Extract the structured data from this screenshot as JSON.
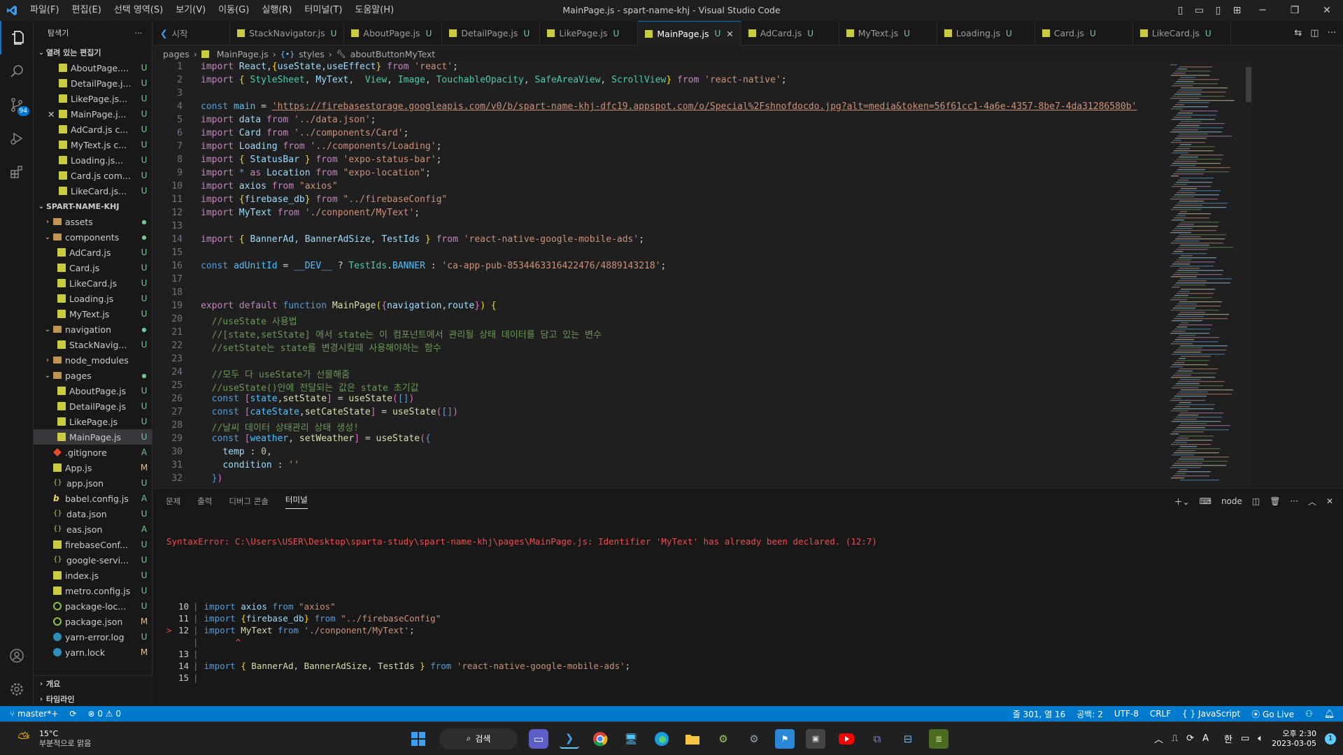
{
  "window": {
    "title": "MainPage.js - spart-name-khj - Visual Studio Code"
  },
  "menu": [
    "파일(F)",
    "편집(E)",
    "선택 영역(S)",
    "보기(V)",
    "이동(G)",
    "실행(R)",
    "터미널(T)",
    "도움말(H)"
  ],
  "activity": {
    "scm_badge": "94"
  },
  "sidebar": {
    "title": "탐색기",
    "more": "···",
    "open_editors_title": "열려 있는 편집기",
    "open_editors": [
      {
        "name": "AboutPage....",
        "status": "U"
      },
      {
        "name": "DetailPage.j...",
        "status": "U"
      },
      {
        "name": "LikePage.js...",
        "status": "U"
      },
      {
        "name": "MainPage.j...",
        "status": "U"
      },
      {
        "name": "AdCard.js c...",
        "status": "U"
      },
      {
        "name": "MyText.js c...",
        "status": "U"
      },
      {
        "name": "Loading.js...",
        "status": "U"
      },
      {
        "name": "Card.js com...",
        "status": "U"
      },
      {
        "name": "LikeCard.js...",
        "status": "U"
      }
    ],
    "project_title": "SPART-NAME-KHJ",
    "tree": [
      {
        "name": "assets",
        "type": "folder",
        "status": "●"
      },
      {
        "name": "components",
        "type": "folder-open",
        "status": "●"
      },
      {
        "name": "AdCard.js",
        "type": "js",
        "status": "U",
        "indent": 2
      },
      {
        "name": "Card.js",
        "type": "js",
        "status": "U",
        "indent": 2
      },
      {
        "name": "LikeCard.js",
        "type": "js",
        "status": "U",
        "indent": 2
      },
      {
        "name": "Loading.js",
        "type": "js",
        "status": "U",
        "indent": 2
      },
      {
        "name": "MyText.js",
        "type": "js",
        "status": "U",
        "indent": 2
      },
      {
        "name": "navigation",
        "type": "folder-open",
        "status": "●"
      },
      {
        "name": "StackNavig...",
        "type": "js",
        "status": "U",
        "indent": 2
      },
      {
        "name": "node_modules",
        "type": "folder",
        "status": ""
      },
      {
        "name": "pages",
        "type": "folder-open",
        "status": "●"
      },
      {
        "name": "AboutPage.js",
        "type": "js",
        "status": "U",
        "indent": 2
      },
      {
        "name": "DetailPage.js",
        "type": "js",
        "status": "U",
        "indent": 2
      },
      {
        "name": "LikePage.js",
        "type": "js",
        "status": "U",
        "indent": 2
      },
      {
        "name": "MainPage.js",
        "type": "js",
        "status": "U",
        "indent": 2,
        "selected": true
      },
      {
        "name": ".gitignore",
        "type": "git",
        "status": "A"
      },
      {
        "name": "App.js",
        "type": "js",
        "status": "M"
      },
      {
        "name": "app.json",
        "type": "json",
        "status": "U"
      },
      {
        "name": "babel.config.js",
        "type": "babel",
        "status": "A"
      },
      {
        "name": "data.json",
        "type": "json",
        "status": "U"
      },
      {
        "name": "eas.json",
        "type": "json",
        "status": "A"
      },
      {
        "name": "firebaseConf...",
        "type": "js",
        "status": "U"
      },
      {
        "name": "google-servi...",
        "type": "json",
        "status": "U"
      },
      {
        "name": "index.js",
        "type": "js",
        "status": "U"
      },
      {
        "name": "metro.config.js",
        "type": "js",
        "status": "U"
      },
      {
        "name": "package-loc...",
        "type": "pkg",
        "status": "U"
      },
      {
        "name": "package.json",
        "type": "pkg",
        "status": "M"
      },
      {
        "name": "yarn-error.log",
        "type": "yarn",
        "status": "U"
      },
      {
        "name": "yarn.lock",
        "type": "yarn",
        "status": "M"
      }
    ],
    "outline": "개요",
    "timeline": "타임라인"
  },
  "tabs": [
    {
      "label": "시작",
      "status": "",
      "kind": "vscode"
    },
    {
      "label": "StackNavigator.js",
      "status": "U"
    },
    {
      "label": "AboutPage.js",
      "status": "U"
    },
    {
      "label": "DetailPage.js",
      "status": "U"
    },
    {
      "label": "LikePage.js",
      "status": "U"
    },
    {
      "label": "MainPage.js",
      "status": "U",
      "active": true
    },
    {
      "label": "AdCard.js",
      "status": "U"
    },
    {
      "label": "MyText.js",
      "status": "U"
    },
    {
      "label": "Loading.js",
      "status": "U"
    },
    {
      "label": "Card.js",
      "status": "U"
    },
    {
      "label": "LikeCard.js",
      "status": "U"
    }
  ],
  "breadcrumbs": [
    "pages",
    "MainPage.js",
    "styles",
    "aboutButtonMyText"
  ],
  "code_lines": [
    [
      [
        "kw",
        "import "
      ],
      [
        "var",
        "React"
      ],
      [
        "",
        ","
      ],
      [
        "br",
        "{"
      ],
      [
        "var",
        "useState"
      ],
      [
        "",
        ","
      ],
      [
        "var",
        "useEffect"
      ],
      [
        "br",
        "}"
      ],
      [
        "kw",
        " from "
      ],
      [
        "str",
        "'react'"
      ],
      [
        "",
        ";"
      ]
    ],
    [
      [
        "kw",
        "import "
      ],
      [
        "br",
        "{ "
      ],
      [
        "cl",
        "StyleSheet"
      ],
      [
        "",
        ", "
      ],
      [
        "var",
        "MyText"
      ],
      [
        "",
        ",  "
      ],
      [
        "cl",
        "View"
      ],
      [
        "",
        ", "
      ],
      [
        "cl",
        "Image"
      ],
      [
        "",
        ", "
      ],
      [
        "cl",
        "TouchableOpacity"
      ],
      [
        "",
        ", "
      ],
      [
        "cl",
        "SafeAreaView"
      ],
      [
        "",
        ", "
      ],
      [
        "cl",
        "ScrollView"
      ],
      [
        "br",
        "}"
      ],
      [
        "kw",
        " from "
      ],
      [
        "str",
        "'react-native'"
      ],
      [
        "",
        ";"
      ]
    ],
    [],
    [
      [
        "kb",
        "const "
      ],
      [
        "cn",
        "main"
      ],
      [
        "",
        " = "
      ],
      [
        "str",
        "'https://firebasestorage.googleapis.com/v0/b/spart-name-khj-dfc19.appspot.com/o/Special%2Fshnofdocdo.jpg?alt=media&token=56f61cc1-4a6e-4357-8be7-4da31286580b'"
      ]
    ],
    [
      [
        "kw",
        "import "
      ],
      [
        "var",
        "data"
      ],
      [
        "kw",
        " from "
      ],
      [
        "str",
        "'../data.json'"
      ],
      [
        "",
        ";"
      ]
    ],
    [
      [
        "kw",
        "import "
      ],
      [
        "var",
        "Card"
      ],
      [
        "kw",
        " from "
      ],
      [
        "str",
        "'../components/Card'"
      ],
      [
        "",
        ";"
      ]
    ],
    [
      [
        "kw",
        "import "
      ],
      [
        "var",
        "Loading"
      ],
      [
        "kw",
        " from "
      ],
      [
        "str",
        "'../components/Loading'"
      ],
      [
        "",
        ";"
      ]
    ],
    [
      [
        "kw",
        "import "
      ],
      [
        "br",
        "{ "
      ],
      [
        "var",
        "StatusBar"
      ],
      [
        "br",
        " }"
      ],
      [
        "kw",
        " from "
      ],
      [
        "str",
        "'expo-status-bar'"
      ],
      [
        "",
        ";"
      ]
    ],
    [
      [
        "kw",
        "import "
      ],
      [
        "kb",
        "* "
      ],
      [
        "kw",
        "as "
      ],
      [
        "var",
        "Location"
      ],
      [
        "kw",
        " from "
      ],
      [
        "str",
        "\"expo-location\""
      ],
      [
        "",
        ";"
      ]
    ],
    [
      [
        "kw",
        "import "
      ],
      [
        "var",
        "axios"
      ],
      [
        "kw",
        " from "
      ],
      [
        "str",
        "\"axios\""
      ]
    ],
    [
      [
        "kw",
        "import "
      ],
      [
        "br",
        "{"
      ],
      [
        "var",
        "firebase_db"
      ],
      [
        "br",
        "}"
      ],
      [
        "kw",
        " from "
      ],
      [
        "str",
        "\"../firebaseConfig\""
      ]
    ],
    [
      [
        "kw",
        "import "
      ],
      [
        "var",
        "MyText"
      ],
      [
        "kw",
        " from "
      ],
      [
        "str",
        "'./conponent/MyText'"
      ],
      [
        "",
        ";"
      ]
    ],
    [],
    [
      [
        "kw",
        "import "
      ],
      [
        "br",
        "{ "
      ],
      [
        "var",
        "BannerAd"
      ],
      [
        "",
        ", "
      ],
      [
        "var",
        "BannerAdSize"
      ],
      [
        "",
        ", "
      ],
      [
        "var",
        "TestIds"
      ],
      [
        "br",
        " }"
      ],
      [
        "kw",
        " from "
      ],
      [
        "str",
        "'react-native-google-mobile-ads'"
      ],
      [
        "",
        ";"
      ]
    ],
    [],
    [
      [
        "kb",
        "const "
      ],
      [
        "cn",
        "adUnitId"
      ],
      [
        "",
        " = "
      ],
      [
        "cn",
        "__DEV__"
      ],
      [
        "",
        " ? "
      ],
      [
        "cl",
        "TestIds"
      ],
      [
        "",
        "."
      ],
      [
        "cn",
        "BANNER"
      ],
      [
        "",
        " : "
      ],
      [
        "str",
        "'ca-app-pub-8534463316422476/4889143218'"
      ],
      [
        "",
        ";"
      ]
    ],
    [],
    [],
    [
      [
        "kw",
        "export default "
      ],
      [
        "kb",
        "function "
      ],
      [
        "fn",
        "MainPage"
      ],
      [
        "br",
        "("
      ],
      [
        "br2",
        "{"
      ],
      [
        "var",
        "navigation"
      ],
      [
        "",
        ","
      ],
      [
        "var",
        "route"
      ],
      [
        "br2",
        "}"
      ],
      [
        "br",
        ")"
      ],
      [
        "",
        " "
      ],
      [
        "br",
        "{"
      ]
    ],
    [
      [
        "",
        "  "
      ],
      [
        "cm",
        "//useState 사용법"
      ]
    ],
    [
      [
        "",
        "  "
      ],
      [
        "cm",
        "//[state,setState] 에서 state는 이 컴포넌트에서 관리될 상태 데이터를 담고 있는 변수"
      ]
    ],
    [
      [
        "",
        "  "
      ],
      [
        "cm",
        "//setState는 state를 변경시킬때 사용해야하는 함수"
      ]
    ],
    [],
    [
      [
        "",
        "  "
      ],
      [
        "cm",
        "//모두 다 useState가 선물해줌"
      ]
    ],
    [
      [
        "",
        "  "
      ],
      [
        "cm",
        "//useState()안에 전달되는 값은 state 초기값"
      ]
    ],
    [
      [
        "",
        "  "
      ],
      [
        "kb",
        "const "
      ],
      [
        "br2",
        "["
      ],
      [
        "cn",
        "state"
      ],
      [
        "",
        ","
      ],
      [
        "fn",
        "setState"
      ],
      [
        "br2",
        "]"
      ],
      [
        "",
        " = "
      ],
      [
        "fn",
        "useState"
      ],
      [
        "br2",
        "("
      ],
      [
        "kb",
        "[]"
      ],
      [
        "br2",
        ")"
      ]
    ],
    [
      [
        "",
        "  "
      ],
      [
        "kb",
        "const "
      ],
      [
        "br2",
        "["
      ],
      [
        "cn",
        "cateState"
      ],
      [
        "",
        ","
      ],
      [
        "fn",
        "setCateState"
      ],
      [
        "br2",
        "]"
      ],
      [
        "",
        " = "
      ],
      [
        "fn",
        "useState"
      ],
      [
        "br2",
        "("
      ],
      [
        "kb",
        "[]"
      ],
      [
        "br2",
        ")"
      ]
    ],
    [
      [
        "",
        "  "
      ],
      [
        "cm",
        "//날씨 데이터 상태관리 상태 생성!"
      ]
    ],
    [
      [
        "",
        "  "
      ],
      [
        "kb",
        "const "
      ],
      [
        "br2",
        "["
      ],
      [
        "cn",
        "weather"
      ],
      [
        "",
        ", "
      ],
      [
        "fn",
        "setWeather"
      ],
      [
        "br2",
        "]"
      ],
      [
        "",
        " = "
      ],
      [
        "fn",
        "useState"
      ],
      [
        "br2",
        "("
      ],
      [
        "kb",
        "{"
      ]
    ],
    [
      [
        "",
        "    "
      ],
      [
        "var",
        "temp"
      ],
      [
        "",
        " : "
      ],
      [
        "num",
        "0"
      ],
      [
        "",
        ","
      ]
    ],
    [
      [
        "",
        "    "
      ],
      [
        "var",
        "condition"
      ],
      [
        "",
        " : "
      ],
      [
        "str",
        "''"
      ]
    ],
    [
      [
        "",
        "  "
      ],
      [
        "kb",
        "}"
      ],
      [
        "br2",
        ")"
      ]
    ]
  ],
  "panel": {
    "tabs": [
      "문제",
      "출력",
      "디버그 콘솔",
      "터미널"
    ],
    "active_tab": "터미널",
    "shell": "node",
    "error": "SyntaxError: C:\\Users\\USER\\Desktop\\sparta-study\\spart-name-khj\\pages\\MainPage.js: Identifier 'MyText' has already been declared. (12:7)",
    "snippet": [
      {
        "ln": "10",
        "marker": "",
        "code": [
          [
            "kb",
            "import "
          ],
          [
            "var",
            "axios "
          ],
          [
            "kb",
            "from "
          ],
          [
            "str",
            "\"axios\""
          ]
        ]
      },
      {
        "ln": "11",
        "marker": "",
        "code": [
          [
            "kb",
            "import "
          ],
          [
            "br",
            "{"
          ],
          [
            "var",
            "firebase_db"
          ],
          [
            "br",
            "}"
          ],
          [
            "kb",
            " from "
          ],
          [
            "str",
            "\"../firebaseConfig\""
          ]
        ]
      },
      {
        "ln": "12",
        "marker": ">",
        "code": [
          [
            "kb",
            "import "
          ],
          [
            "fn",
            "MyText "
          ],
          [
            "kb",
            "from "
          ],
          [
            "str",
            "'./conponent/MyText'"
          ],
          [
            "",
            ";"
          ]
        ]
      },
      {
        "ln": "",
        "marker": "",
        "code": [
          [
            "err",
            "      ^"
          ]
        ]
      },
      {
        "ln": "13",
        "marker": "",
        "code": []
      },
      {
        "ln": "14",
        "marker": "",
        "code": [
          [
            "kb",
            "import "
          ],
          [
            "br",
            "{ "
          ],
          [
            "fn",
            "BannerAd"
          ],
          [
            "",
            ", "
          ],
          [
            "fn",
            "BannerAdSize"
          ],
          [
            "",
            ", "
          ],
          [
            "fn",
            "TestIds"
          ],
          [
            "br",
            " }"
          ],
          [
            "kb",
            " from "
          ],
          [
            "str",
            "'react-native-google-mobile-ads'"
          ],
          [
            "",
            ";"
          ]
        ]
      },
      {
        "ln": "15",
        "marker": "",
        "code": []
      }
    ]
  },
  "status": {
    "branch": "master*+",
    "errors": "0",
    "warnings": "0",
    "position": "줄 301, 열 16",
    "spaces": "공백: 2",
    "encoding": "UTF-8",
    "eol": "CRLF",
    "language": "JavaScript",
    "golive": "Go Live"
  },
  "taskbar": {
    "temp": "15°C",
    "weather": "부분적으로 맑음",
    "search": "검색",
    "ime": "한",
    "time": "오후 2:30",
    "date": "2023-03-05",
    "notif": "1",
    "letter": "A"
  }
}
